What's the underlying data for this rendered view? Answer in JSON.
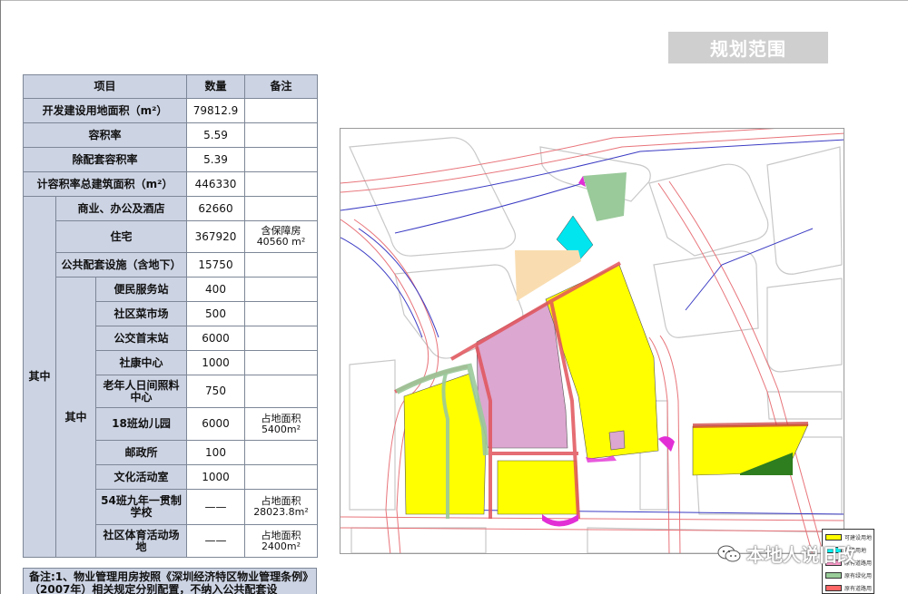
{
  "title": "规划范围",
  "table": {
    "headers": [
      "项目",
      "数量",
      "备注"
    ],
    "rows": [
      {
        "label": "开发建设用地面积（m²）",
        "value": "79812.9",
        "note": ""
      },
      {
        "label": "容积率",
        "value": "5.59",
        "note": ""
      },
      {
        "label": "除配套容积率",
        "value": "5.39",
        "note": ""
      },
      {
        "label": "计容积率总建筑面积（m²）",
        "value": "446330",
        "note": ""
      }
    ],
    "group_label": "其中",
    "sub_rows": [
      {
        "label": "商业、办公及酒店",
        "value": "62660",
        "note": ""
      },
      {
        "label": "住宅",
        "value": "367920",
        "note": "含保障房 40560 m²"
      },
      {
        "label": "公共配套设施（含地下）",
        "value": "15750",
        "note": ""
      }
    ],
    "nested_label": "其中",
    "nested_rows": [
      {
        "label": "便民服务站",
        "value": "400",
        "note": ""
      },
      {
        "label": "社区菜市场",
        "value": "500",
        "note": ""
      },
      {
        "label": "公交首末站",
        "value": "6000",
        "note": ""
      },
      {
        "label": "社康中心",
        "value": "1000",
        "note": ""
      },
      {
        "label": "老年人日间照料中心",
        "value": "750",
        "note": ""
      },
      {
        "label": "18班幼儿园",
        "value": "6000",
        "note": "占地面积 5400m²"
      },
      {
        "label": "邮政所",
        "value": "100",
        "note": ""
      },
      {
        "label": "文化活动室",
        "value": "1000",
        "note": ""
      },
      {
        "label": "54班九年一贯制学校",
        "value": "——",
        "note": "占地面积 28023.8m²"
      },
      {
        "label": "社区体育活动场地",
        "value": "——",
        "note": "占地面积 2400m²"
      }
    ]
  },
  "note": "备注:1、物业管理用房按照《深圳经济特区物业管理条例》（2007年）相关规定分别配置，不纳入公共配套设",
  "legend": [
    {
      "color": "#ffff00",
      "label": "可建设用地"
    },
    {
      "color": "#00ffff",
      "label": "道路用地"
    },
    {
      "color": "#ff99cc",
      "label": "原有道路用地"
    },
    {
      "color": "#99cc99",
      "label": "原有绿化用地"
    },
    {
      "color": "#ff6666",
      "label": "原有道路用地"
    }
  ],
  "watermark": "本地人说旧改",
  "colors": {
    "title_bg": "#cfcfcf",
    "table_header_bg": "#ccd3e3",
    "residential": "#ffff00",
    "school": "#dca7d0",
    "green": "#9ac99a",
    "cyan": "#00e5ee",
    "peach": "#f9ddb1",
    "road_red": "#e1545b",
    "dark_green": "#2e7d1e"
  }
}
